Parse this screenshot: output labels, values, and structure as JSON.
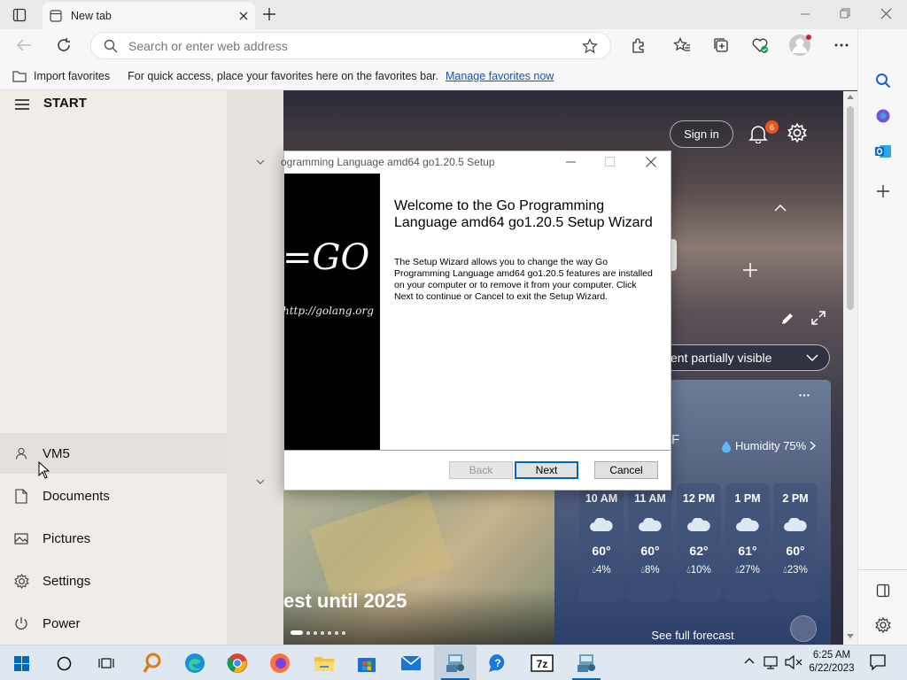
{
  "browser": {
    "tab_title": "New tab",
    "address_placeholder": "Search or enter web address",
    "favbar": {
      "import_label": "Import favorites",
      "message": "For quick access, place your favorites here on the favorites bar.",
      "manage_link": "Manage favorites now"
    }
  },
  "start_menu": {
    "title": "START",
    "user": "VM5",
    "items": [
      {
        "label": "Documents",
        "icon": "document-icon"
      },
      {
        "label": "Pictures",
        "icon": "pictures-icon"
      },
      {
        "label": "Settings",
        "icon": "gear-icon"
      },
      {
        "label": "Power",
        "icon": "power-icon"
      }
    ]
  },
  "newtab": {
    "sign_in": "Sign in",
    "notification_count": "6",
    "content_label": "ent partially visible",
    "headline": "est until 2025",
    "weather": {
      "temp_fragment": "F",
      "humidity": "Humidity 75%",
      "hours": [
        {
          "time": "10 AM",
          "temp": "60°",
          "precip": "4%"
        },
        {
          "time": "11 AM",
          "temp": "60°",
          "precip": "8%"
        },
        {
          "time": "12 PM",
          "temp": "62°",
          "precip": "10%"
        },
        {
          "time": "1 PM",
          "temp": "61°",
          "precip": "27%"
        },
        {
          "time": "2 PM",
          "temp": "60°",
          "precip": "23%"
        }
      ],
      "forecast_link": "See full forecast"
    }
  },
  "dialog": {
    "title": "ogramming Language amd64 go1.20.5 Setup",
    "logo_text": "=GO",
    "logo_url": "http://golang.org",
    "heading": "Welcome to the Go Programming Language amd64 go1.20.5 Setup Wizard",
    "body": "The Setup Wizard allows you to change the way Go Programming Language amd64 go1.20.5 features are installed on your computer or to remove it from your computer. Click Next to continue or Cancel to exit the Setup Wizard.",
    "back": "Back",
    "next": "Next",
    "cancel": "Cancel"
  },
  "taskbar": {
    "time": "6:25 AM",
    "date": "6/22/2023",
    "apps": [
      "search-app",
      "edge",
      "chrome",
      "firefox",
      "file-explorer",
      "store",
      "mail",
      "setup",
      "quick-assist",
      "7zip",
      "installer"
    ]
  },
  "colors": {
    "accent": "#0067c0",
    "badge": "#e8561f",
    "taskbar": "#dfe7f0"
  }
}
